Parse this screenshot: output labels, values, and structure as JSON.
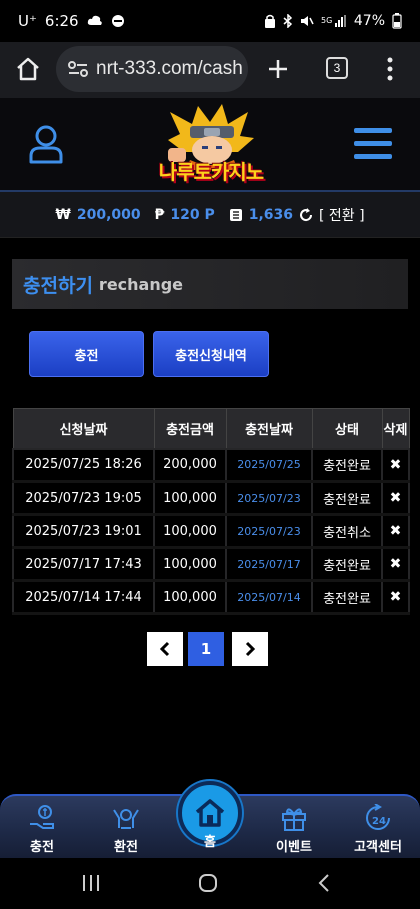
{
  "status_bar": {
    "carrier": "U⁺",
    "time": "6:26",
    "battery": "47%"
  },
  "browser": {
    "url": "nrt-333.com/cash",
    "tab_count": "3"
  },
  "site": {
    "logo_text": "나루토카지노"
  },
  "balance": {
    "won_symbol": "₩",
    "won_value": "200,000",
    "point_symbol": "₱",
    "point_value": "120 P",
    "chip_value": "1,636",
    "convert_label": "[ 전환 ]"
  },
  "section": {
    "title_ko": "충전하기",
    "title_en": "rechange"
  },
  "buttons": {
    "charge": "충전",
    "history": "충전신청내역"
  },
  "table": {
    "headers": [
      "신청날짜",
      "충전금액",
      "충전날짜",
      "상태",
      "삭제"
    ],
    "rows": [
      {
        "request_date": "2025/07/25 18:26",
        "amount": "200,000",
        "charge_date": "2025/07/25",
        "status": "충전완료",
        "delete": "✖"
      },
      {
        "request_date": "2025/07/23 19:05",
        "amount": "100,000",
        "charge_date": "2025/07/23",
        "status": "충전완료",
        "delete": "✖"
      },
      {
        "request_date": "2025/07/23 19:01",
        "amount": "100,000",
        "charge_date": "2025/07/23",
        "status": "충전취소",
        "delete": "✖"
      },
      {
        "request_date": "2025/07/17 17:43",
        "amount": "100,000",
        "charge_date": "2025/07/17",
        "status": "충전완료",
        "delete": "✖"
      },
      {
        "request_date": "2025/07/14 17:44",
        "amount": "100,000",
        "charge_date": "2025/07/14",
        "status": "충전완료",
        "delete": "✖"
      }
    ]
  },
  "pagination": {
    "prev": "‹",
    "current": "1",
    "next": "›"
  },
  "bottom_nav": {
    "charge": "충전",
    "exchange": "환전",
    "home": "홈",
    "event": "이벤트",
    "support": "고객센터"
  },
  "colors": {
    "accent_blue": "#3d8ff0",
    "button_blue": "#2a4fd8",
    "logo_yellow": "#ffd21c"
  }
}
